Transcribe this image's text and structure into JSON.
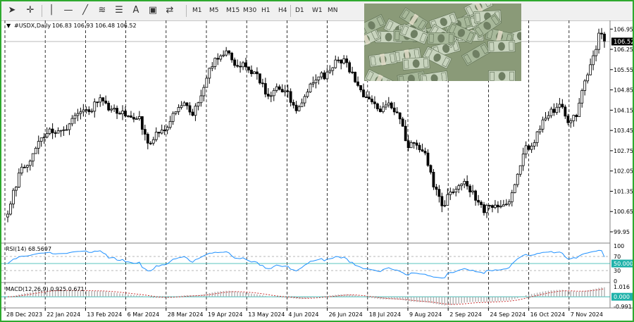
{
  "toolbar": {
    "tools": [
      "cursor-icon",
      "crosshair-icon",
      "vertical-line-icon",
      "horizontal-line-icon",
      "trendline-icon",
      "fibonacci-icon",
      "fibonacci-fan-icon",
      "text-icon",
      "text-label-icon",
      "shapes-icon"
    ],
    "timeframes": [
      "M1",
      "M5",
      "M15",
      "M30",
      "H1",
      "H4",
      "D1",
      "W1",
      "MN"
    ]
  },
  "colors": {
    "bull": "#ffffff",
    "bear": "#000000",
    "rsi_line": "#1e90ff",
    "macd_signal": "#c83232",
    "level_line": "#20b2aa",
    "frame": "#2ea92e"
  },
  "chart_data": {
    "type": "candlestick",
    "symbol_header": "#USDX,Daily",
    "ohlc_header": "106.83 106.93 106.48 106.52",
    "current_price_label": "106.52",
    "grid": true,
    "ylim": [
      99.95,
      107.2
    ],
    "price_ticks": [
      "106.95",
      "106.25",
      "105.55",
      "104.85",
      "104.15",
      "103.45",
      "102.75",
      "102.05",
      "101.35",
      "100.65",
      "99.95"
    ],
    "date_labels": [
      "28 Dec 2023",
      "22 Jan 2024",
      "13 Feb 2024",
      "6 Mar 2024",
      "28 Mar 2024",
      "19 Apr 2024",
      "13 May 2024",
      "4 Jun 2024",
      "26 Jun 2024",
      "18 Jul 2024",
      "9 Aug 2024",
      "2 Sep 2024",
      "24 Sep 2024",
      "16 Oct 2024",
      "7 Nov 2024"
    ],
    "anchors": [
      [
        0,
        100.7
      ],
      [
        4,
        101.9
      ],
      [
        8,
        102.5
      ],
      [
        12,
        103.2
      ],
      [
        16,
        103.5
      ],
      [
        20,
        103.4
      ],
      [
        23,
        103.9
      ],
      [
        26,
        104.0
      ],
      [
        30,
        104.2
      ],
      [
        33,
        104.6
      ],
      [
        36,
        104.1
      ],
      [
        40,
        104.1
      ],
      [
        44,
        103.8
      ],
      [
        47,
        103.8
      ],
      [
        50,
        102.9
      ],
      [
        53,
        103.4
      ],
      [
        56,
        103.5
      ],
      [
        60,
        104.2
      ],
      [
        63,
        104.3
      ],
      [
        66,
        104.0
      ],
      [
        69,
        104.6
      ],
      [
        72,
        105.6
      ],
      [
        75,
        106.0
      ],
      [
        78,
        106.1
      ],
      [
        81,
        105.8
      ],
      [
        84,
        105.7
      ],
      [
        87,
        105.4
      ],
      [
        90,
        105.2
      ],
      [
        93,
        104.6
      ],
      [
        96,
        104.9
      ],
      [
        100,
        104.7
      ],
      [
        103,
        104.1
      ],
      [
        106,
        104.7
      ],
      [
        109,
        105.1
      ],
      [
        112,
        105.3
      ],
      [
        115,
        105.5
      ],
      [
        118,
        105.9
      ],
      [
        121,
        105.8
      ],
      [
        124,
        105.2
      ],
      [
        127,
        104.7
      ],
      [
        130,
        104.3
      ],
      [
        133,
        104.2
      ],
      [
        136,
        104.4
      ],
      [
        140,
        103.9
      ],
      [
        143,
        102.9
      ],
      [
        146,
        103.0
      ],
      [
        149,
        102.7
      ],
      [
        152,
        101.6
      ],
      [
        155,
        100.8
      ],
      [
        158,
        101.3
      ],
      [
        161,
        101.6
      ],
      [
        164,
        101.6
      ],
      [
        167,
        101.1
      ],
      [
        170,
        100.7
      ],
      [
        173,
        100.8
      ],
      [
        176,
        100.9
      ],
      [
        179,
        101.1
      ],
      [
        182,
        102.0
      ],
      [
        185,
        102.8
      ],
      [
        188,
        103.1
      ],
      [
        191,
        103.8
      ],
      [
        194,
        104.1
      ],
      [
        197,
        104.3
      ],
      [
        200,
        103.8
      ],
      [
        203,
        103.9
      ],
      [
        205,
        104.8
      ],
      [
        208,
        105.6
      ],
      [
        211,
        106.7
      ],
      [
        213,
        106.6
      ]
    ],
    "rsi": {
      "label": "RSI(14) 68.5697",
      "period": 14,
      "value": 68.5697,
      "scale_ticks": [
        "100",
        "70",
        "50.0000",
        "30",
        "0"
      ],
      "levels": [
        70,
        50,
        30
      ]
    },
    "macd": {
      "label": "MACD(12,26,9) 0.925 0.671",
      "fast": 12,
      "slow": 26,
      "signal": 9,
      "main": 0.925,
      "signal_value": 0.671,
      "scale_ticks": [
        "1.016",
        "0.000",
        "-0.991"
      ]
    }
  }
}
